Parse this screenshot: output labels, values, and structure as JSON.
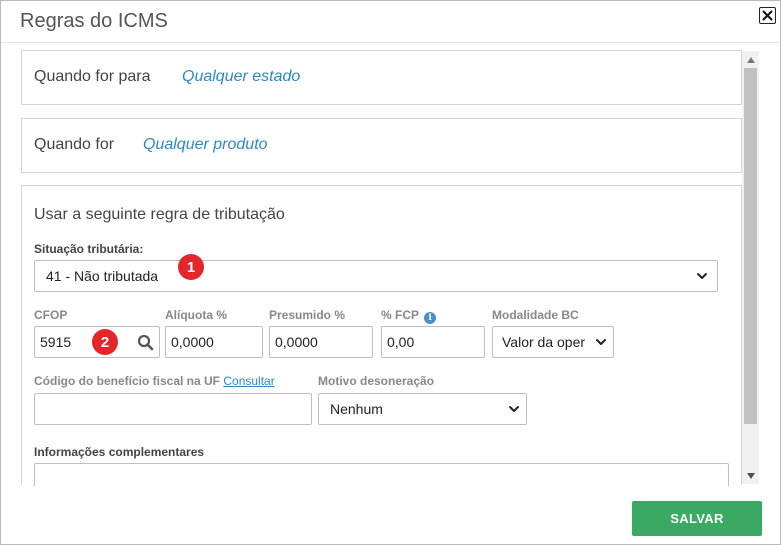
{
  "window": {
    "title": "Regras do ICMS",
    "close_icon": "close-icon"
  },
  "conditions": {
    "destination": {
      "label": "Quando for para",
      "value": "Qualquer estado"
    },
    "product": {
      "label": "Quando for",
      "value": "Qualquer produto"
    }
  },
  "rule": {
    "section_title": "Usar a seguinte regra de tributação",
    "situacao": {
      "label": "Situação tributária:",
      "value": "41 - Não tributada",
      "badge": "1"
    },
    "cfop": {
      "label": "CFOP",
      "value": "5915",
      "badge": "2",
      "icon": "search-icon"
    },
    "aliquota": {
      "label": "Alíquota %",
      "value": "0,0000"
    },
    "presumido": {
      "label": "Presumido %",
      "value": "0,0000"
    },
    "fcp": {
      "label": "% FCP",
      "value": "0,00",
      "icon": "info-icon"
    },
    "modalidade": {
      "label": "Modalidade BC",
      "value": "Valor da oper"
    },
    "beneficio": {
      "label": "Código do benefício fiscal na UF",
      "link": "Consultar",
      "value": ""
    },
    "motivo": {
      "label": "Motivo desoneração",
      "value": "Nenhum"
    },
    "info": {
      "label": "Informações complementares",
      "value": ""
    }
  },
  "footer": {
    "save_label": "SALVAR"
  },
  "colors": {
    "accent_link": "#2a8ac6",
    "save_button": "#3aaa63",
    "badge": "#e3262b"
  }
}
